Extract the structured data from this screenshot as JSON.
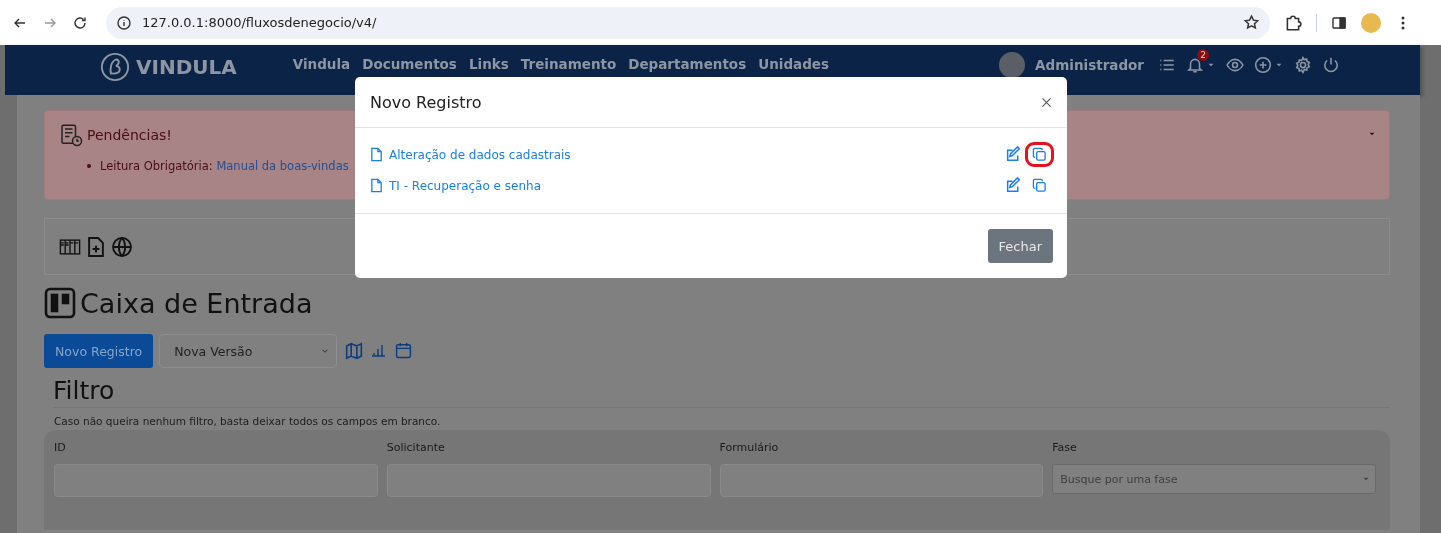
{
  "browser": {
    "url": "127.0.0.1:8000/fluxosdenegocio/v4/"
  },
  "navbar": {
    "brand": "VINDULA",
    "links": [
      "Vindula",
      "Documentos",
      "Links",
      "Treinamento",
      "Departamentos",
      "Unidades"
    ],
    "user": "Administrador",
    "notification_count": "2"
  },
  "alert": {
    "title": "Pendências!",
    "items": [
      {
        "label": "Leitura Obrigatória:",
        "link": "Manual da boas-vindas"
      }
    ]
  },
  "page": {
    "title": "Caixa de Entrada",
    "new_button": "Novo Registro",
    "version_select": "Nova Versão"
  },
  "filter": {
    "title": "Filtro",
    "hint": "Caso não queira nenhum filtro, basta deixar todos os campos em branco.",
    "fields": [
      {
        "label": "ID",
        "kind": "text"
      },
      {
        "label": "Solicitante",
        "kind": "text"
      },
      {
        "label": "Formulário",
        "kind": "text"
      },
      {
        "label": "Fase",
        "kind": "select",
        "placeholder": "Busque por uma fase"
      }
    ]
  },
  "modal": {
    "title": "Novo Registro",
    "items": [
      {
        "label": "Alteração de dados cadastrais",
        "highlighted": true
      },
      {
        "label": "TI - Recuperação e senha",
        "highlighted": false
      }
    ],
    "close_button": "Fechar"
  }
}
